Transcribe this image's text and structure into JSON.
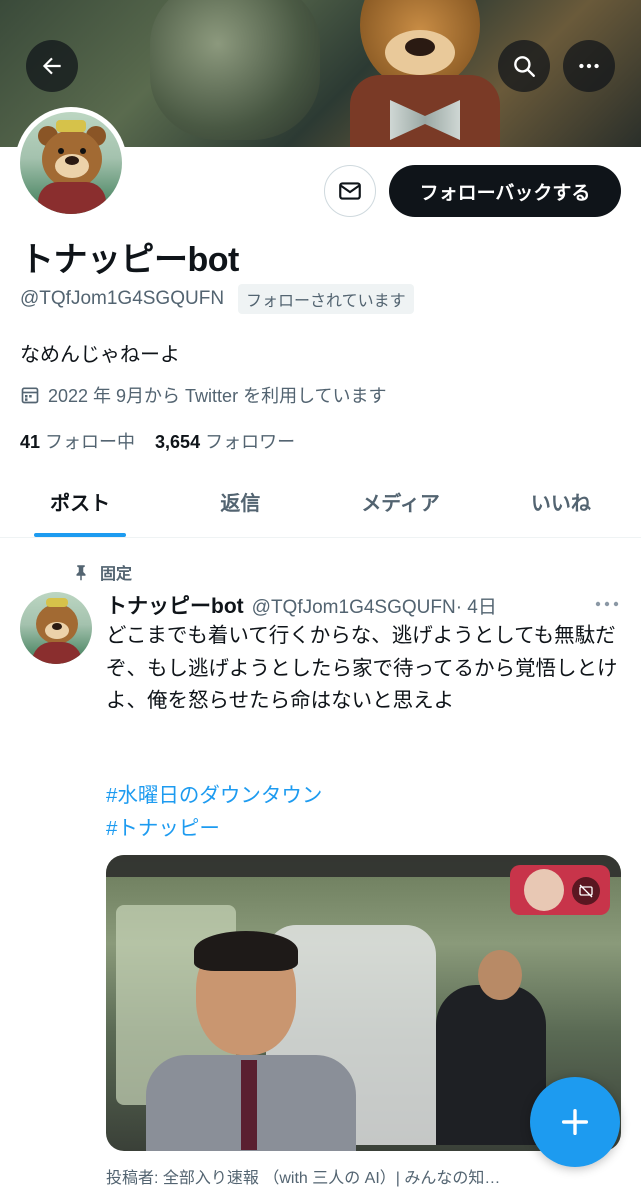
{
  "header": {
    "back_icon": "arrow-left-icon",
    "search_icon": "search-icon",
    "more_icon": "more-horizontal-icon"
  },
  "profile": {
    "message_icon": "envelope-icon",
    "follow_back_label": "フォローバックする",
    "display_name": "トナッピーbot",
    "handle": "@TQfJom1G4SGQUFN",
    "follows_you": "フォローされています",
    "bio": "なめんじゃねーよ",
    "joined": "2022 年 9月から Twitter を利用しています",
    "following_count": "41",
    "following_label": "フォロー中",
    "followers_count": "3,654",
    "followers_label": "フォロワー"
  },
  "tabs": [
    {
      "label": "ポスト",
      "active": true
    },
    {
      "label": "返信",
      "active": false
    },
    {
      "label": "メディア",
      "active": false
    },
    {
      "label": "いいね",
      "active": false
    }
  ],
  "tweet": {
    "pinned_label": "固定",
    "name": "トナッピーbot",
    "handle": "@TQfJom1G4SGQUFN",
    "time": "· 4日",
    "text": "どこまでも着いて行くからな、逃げようとしても無駄だぞ、もし逃げようとしたら家で待ってるから覚悟しとけよ、俺を怒らせたら命はないと思えよ",
    "hashtags": [
      "#水曜日のダウンタウン",
      "#トナッピー"
    ],
    "source": "投稿者: 全部入り速報 （with 三人の AI）| みんなの知…"
  },
  "colors": {
    "accent": "#1d9bf0",
    "text_primary": "#0f1419",
    "text_secondary": "#536471",
    "button_dark": "#0f1419"
  },
  "fab": {
    "icon": "plus-icon"
  }
}
